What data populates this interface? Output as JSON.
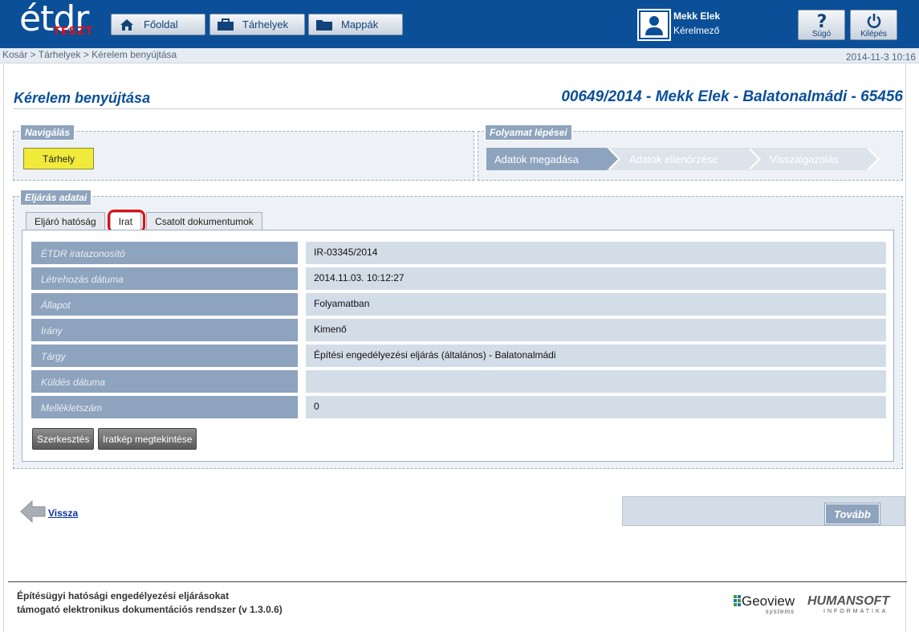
{
  "brand": {
    "logo_text": "étdr",
    "logo_badge": "TESZT"
  },
  "topnav": [
    {
      "label": "Főoldal",
      "icon": "home-icon"
    },
    {
      "label": "Tárhelyek",
      "icon": "briefcase-icon"
    },
    {
      "label": "Mappák",
      "icon": "folder-icon"
    }
  ],
  "user": {
    "name": "Mekk Elek",
    "role": "Kérelmező"
  },
  "header_buttons": {
    "help": "Súgó",
    "logout": "Kilépés"
  },
  "breadcrumb": "Kosár > Tárhelyek > Kérelem benyújtása",
  "datetime": "2014-11-3 10:16",
  "page": {
    "title": "Kérelem benyújtása",
    "case_title": "00649/2014 - Mekk Elek - Balatonalmádi - 65456"
  },
  "navigation": {
    "legend": "Navigálás",
    "storage_button": "Tárhely"
  },
  "process": {
    "legend": "Folyamat lépései",
    "steps": [
      "Adatok megadása",
      "Adatok ellenőrzése",
      "Visszaigazolás"
    ]
  },
  "procedure": {
    "legend": "Eljárás adatai",
    "tabs": [
      "Eljáró hatóság",
      "Irat",
      "Csatolt dokumentumok"
    ],
    "active_tab": "Irat",
    "rows": [
      {
        "label": "ÉTDR iratazonosító",
        "value": "IR-03345/2014"
      },
      {
        "label": "Létrehozás dátuma",
        "value": "2014.11.03. 10:12:27"
      },
      {
        "label": "Állapot",
        "value": "Folyamatban"
      },
      {
        "label": "Irány",
        "value": "Kimenő"
      },
      {
        "label": "Tárgy",
        "value": "Építési engedélyezési eljárás (általános) - Balatonalmádi"
      },
      {
        "label": "Küldés dátuma",
        "value": ""
      },
      {
        "label": "Mellékletszám",
        "value": "0"
      }
    ],
    "buttons": {
      "edit": "Szerkesztés",
      "view_image": "Iratkép megtekintése"
    }
  },
  "bottom_nav": {
    "back": "Vissza",
    "next": "Tovább"
  },
  "footer": {
    "line1": "Építésügyi hatósági engedélyezési eljárásokat",
    "line2": "támogató elektronikus dokumentációs rendszer (v 1.3.0.6)",
    "geoview_name": "Geoview",
    "geoview_sub": "systems",
    "humansoft_name": "HUMANSOFT",
    "humansoft_sub": "INFORMATIKA"
  },
  "colors": {
    "header_blue": "#0b4f98",
    "panel_blue": "#8ea3bd",
    "value_bg": "#d3dde8",
    "highlight_red": "#e01010",
    "storage_yellow": "#f0ea3a"
  }
}
